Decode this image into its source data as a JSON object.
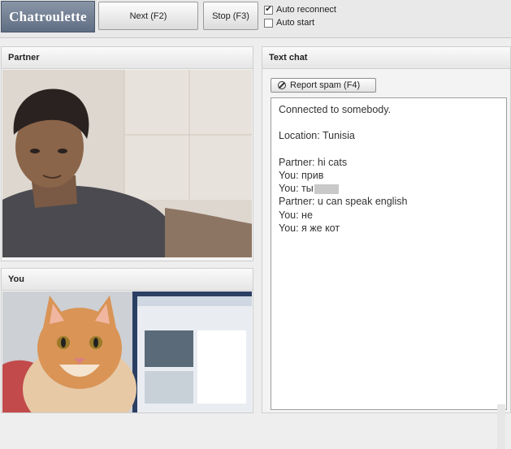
{
  "app": {
    "logo": "Chatroulette"
  },
  "toolbar": {
    "next_label": "Next (F2)",
    "stop_label": "Stop (F3)",
    "auto_reconnect": {
      "label": "Auto reconnect",
      "checked": true
    },
    "auto_start": {
      "label": "Auto start",
      "checked": false
    }
  },
  "panels": {
    "partner_title": "Partner",
    "you_title": "You",
    "chat_title": "Text chat"
  },
  "chat": {
    "report_label": "Report spam (F4)",
    "system": [
      "Connected to somebody.",
      "Location: Tunisia"
    ],
    "messages": [
      {
        "text": "Partner: hi cats"
      },
      {
        "text": "You: прив"
      },
      {
        "text": "You: ты"
      },
      {
        "text": "Partner: u can speak english"
      },
      {
        "text": "You: не"
      },
      {
        "text": "You: я же кот"
      }
    ]
  }
}
